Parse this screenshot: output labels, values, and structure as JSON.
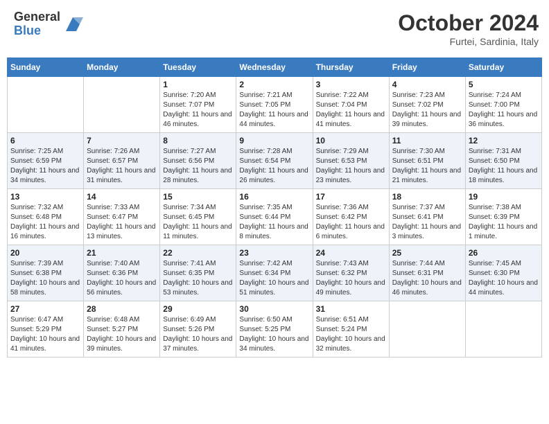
{
  "header": {
    "logo_general": "General",
    "logo_blue": "Blue",
    "month_title": "October 2024",
    "location": "Furtei, Sardinia, Italy"
  },
  "calendar": {
    "columns": [
      "Sunday",
      "Monday",
      "Tuesday",
      "Wednesday",
      "Thursday",
      "Friday",
      "Saturday"
    ],
    "weeks": [
      [
        {
          "day": "",
          "info": ""
        },
        {
          "day": "",
          "info": ""
        },
        {
          "day": "1",
          "info": "Sunrise: 7:20 AM\nSunset: 7:07 PM\nDaylight: 11 hours and 46 minutes."
        },
        {
          "day": "2",
          "info": "Sunrise: 7:21 AM\nSunset: 7:05 PM\nDaylight: 11 hours and 44 minutes."
        },
        {
          "day": "3",
          "info": "Sunrise: 7:22 AM\nSunset: 7:04 PM\nDaylight: 11 hours and 41 minutes."
        },
        {
          "day": "4",
          "info": "Sunrise: 7:23 AM\nSunset: 7:02 PM\nDaylight: 11 hours and 39 minutes."
        },
        {
          "day": "5",
          "info": "Sunrise: 7:24 AM\nSunset: 7:00 PM\nDaylight: 11 hours and 36 minutes."
        }
      ],
      [
        {
          "day": "6",
          "info": "Sunrise: 7:25 AM\nSunset: 6:59 PM\nDaylight: 11 hours and 34 minutes."
        },
        {
          "day": "7",
          "info": "Sunrise: 7:26 AM\nSunset: 6:57 PM\nDaylight: 11 hours and 31 minutes."
        },
        {
          "day": "8",
          "info": "Sunrise: 7:27 AM\nSunset: 6:56 PM\nDaylight: 11 hours and 28 minutes."
        },
        {
          "day": "9",
          "info": "Sunrise: 7:28 AM\nSunset: 6:54 PM\nDaylight: 11 hours and 26 minutes."
        },
        {
          "day": "10",
          "info": "Sunrise: 7:29 AM\nSunset: 6:53 PM\nDaylight: 11 hours and 23 minutes."
        },
        {
          "day": "11",
          "info": "Sunrise: 7:30 AM\nSunset: 6:51 PM\nDaylight: 11 hours and 21 minutes."
        },
        {
          "day": "12",
          "info": "Sunrise: 7:31 AM\nSunset: 6:50 PM\nDaylight: 11 hours and 18 minutes."
        }
      ],
      [
        {
          "day": "13",
          "info": "Sunrise: 7:32 AM\nSunset: 6:48 PM\nDaylight: 11 hours and 16 minutes."
        },
        {
          "day": "14",
          "info": "Sunrise: 7:33 AM\nSunset: 6:47 PM\nDaylight: 11 hours and 13 minutes."
        },
        {
          "day": "15",
          "info": "Sunrise: 7:34 AM\nSunset: 6:45 PM\nDaylight: 11 hours and 11 minutes."
        },
        {
          "day": "16",
          "info": "Sunrise: 7:35 AM\nSunset: 6:44 PM\nDaylight: 11 hours and 8 minutes."
        },
        {
          "day": "17",
          "info": "Sunrise: 7:36 AM\nSunset: 6:42 PM\nDaylight: 11 hours and 6 minutes."
        },
        {
          "day": "18",
          "info": "Sunrise: 7:37 AM\nSunset: 6:41 PM\nDaylight: 11 hours and 3 minutes."
        },
        {
          "day": "19",
          "info": "Sunrise: 7:38 AM\nSunset: 6:39 PM\nDaylight: 11 hours and 1 minute."
        }
      ],
      [
        {
          "day": "20",
          "info": "Sunrise: 7:39 AM\nSunset: 6:38 PM\nDaylight: 10 hours and 58 minutes."
        },
        {
          "day": "21",
          "info": "Sunrise: 7:40 AM\nSunset: 6:36 PM\nDaylight: 10 hours and 56 minutes."
        },
        {
          "day": "22",
          "info": "Sunrise: 7:41 AM\nSunset: 6:35 PM\nDaylight: 10 hours and 53 minutes."
        },
        {
          "day": "23",
          "info": "Sunrise: 7:42 AM\nSunset: 6:34 PM\nDaylight: 10 hours and 51 minutes."
        },
        {
          "day": "24",
          "info": "Sunrise: 7:43 AM\nSunset: 6:32 PM\nDaylight: 10 hours and 49 minutes."
        },
        {
          "day": "25",
          "info": "Sunrise: 7:44 AM\nSunset: 6:31 PM\nDaylight: 10 hours and 46 minutes."
        },
        {
          "day": "26",
          "info": "Sunrise: 7:45 AM\nSunset: 6:30 PM\nDaylight: 10 hours and 44 minutes."
        }
      ],
      [
        {
          "day": "27",
          "info": "Sunrise: 6:47 AM\nSunset: 5:29 PM\nDaylight: 10 hours and 41 minutes."
        },
        {
          "day": "28",
          "info": "Sunrise: 6:48 AM\nSunset: 5:27 PM\nDaylight: 10 hours and 39 minutes."
        },
        {
          "day": "29",
          "info": "Sunrise: 6:49 AM\nSunset: 5:26 PM\nDaylight: 10 hours and 37 minutes."
        },
        {
          "day": "30",
          "info": "Sunrise: 6:50 AM\nSunset: 5:25 PM\nDaylight: 10 hours and 34 minutes."
        },
        {
          "day": "31",
          "info": "Sunrise: 6:51 AM\nSunset: 5:24 PM\nDaylight: 10 hours and 32 minutes."
        },
        {
          "day": "",
          "info": ""
        },
        {
          "day": "",
          "info": ""
        }
      ]
    ]
  }
}
